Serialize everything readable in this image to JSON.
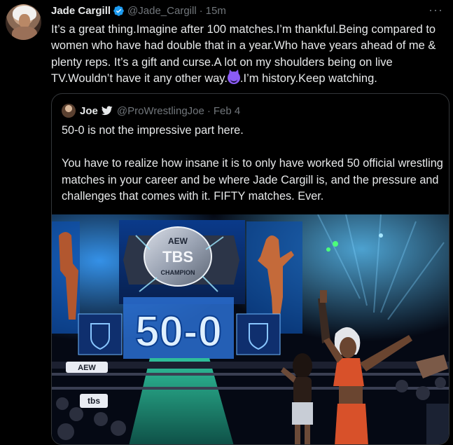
{
  "tweet": {
    "author_name": "Jade Cargill",
    "handle": "@Jade_Cargill",
    "separator": "·",
    "time": "15m",
    "more": "···",
    "text_before_emoji": "It’s a great thing.Imagine after 100 matches.I’m thankful.Being compared to women who have had double that in a year.Who have years ahead of me & plenty reps. It’s a gift and curse.A lot on my shoulders being on live TV.Wouldn’t have it any other way.",
    "text_after_emoji": ".I’m history.Keep watching.",
    "emoji": "smiling-devil-emoji"
  },
  "quoted_tweet": {
    "author_name": "Joe",
    "handle": "@ProWrestlingJoe",
    "separator": "·",
    "date": "Feb 4",
    "paragraph_1": "50-0 is not the impressive part here.",
    "paragraph_2": "You have to realize how insane it is to only have worked 50 official wrestling matches in your career and be where Jade Cargill is, and the pressure and challenges that comes with it. FIFTY matches. Ever.",
    "image": {
      "screen_text": "50-0",
      "belt_text_top": "AEW",
      "belt_text_mid": "TBS",
      "belt_text_bottom": "CHAMPION",
      "banner_left": "AEW",
      "banner_right": "tbs"
    }
  },
  "colors": {
    "background": "#000000",
    "text": "#e7e9ea",
    "muted": "#71767b",
    "verified": "#1d9bf0",
    "border": "#333639"
  }
}
